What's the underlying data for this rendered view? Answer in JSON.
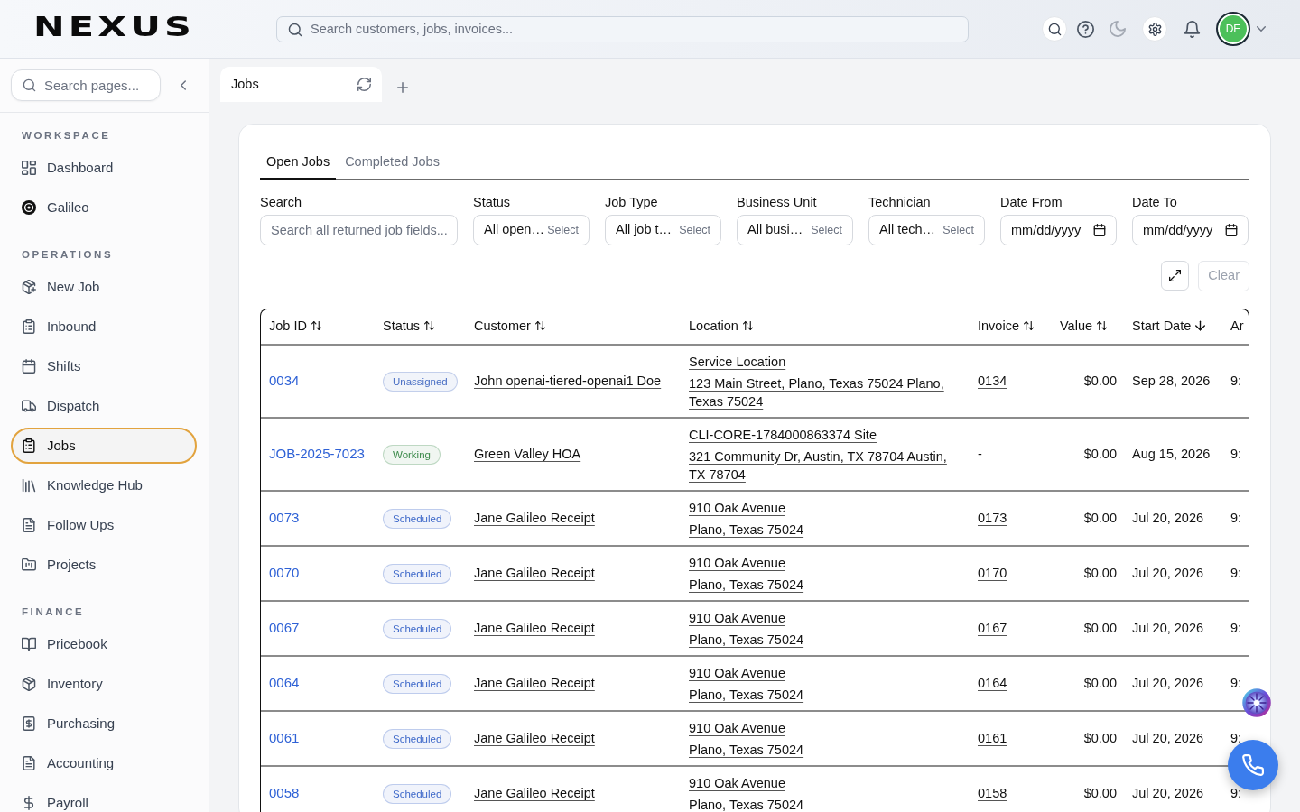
{
  "header": {
    "logo": "NEXUS",
    "search": {
      "placeholder": "Search customers, jobs, invoices..."
    },
    "avatar": {
      "initials": "DE"
    }
  },
  "sidebar": {
    "search": {
      "placeholder": "Search pages..."
    },
    "sections": [
      {
        "title": "WORKSPACE",
        "items": [
          {
            "label": "Dashboard",
            "selected": false
          },
          {
            "label": "Galileo",
            "selected": false
          }
        ]
      },
      {
        "title": "OPERATIONS",
        "items": [
          {
            "label": "New Job",
            "selected": false
          },
          {
            "label": "Inbound",
            "selected": false
          },
          {
            "label": "Shifts",
            "selected": false
          },
          {
            "label": "Dispatch",
            "selected": false
          },
          {
            "label": "Jobs",
            "selected": true
          },
          {
            "label": "Knowledge Hub",
            "selected": false
          },
          {
            "label": "Follow Ups",
            "selected": false
          },
          {
            "label": "Projects",
            "selected": false
          }
        ]
      },
      {
        "title": "FINANCE",
        "items": [
          {
            "label": "Pricebook",
            "selected": false
          },
          {
            "label": "Inventory",
            "selected": false
          },
          {
            "label": "Purchasing",
            "selected": false
          },
          {
            "label": "Accounting",
            "selected": false
          },
          {
            "label": "Payroll",
            "selected": false
          }
        ]
      }
    ]
  },
  "page_tabs": [
    {
      "label": "Jobs",
      "selected": true
    }
  ],
  "jobs_panel": {
    "tabs": [
      {
        "label": "Open Jobs",
        "selected": true
      },
      {
        "label": "Completed Jobs",
        "selected": false
      }
    ],
    "filters": [
      {
        "kind": "text",
        "label": "Search",
        "placeholder": "Search all returned job fields..."
      },
      {
        "kind": "select",
        "label": "Status",
        "value": "All open…",
        "hint": "Select"
      },
      {
        "kind": "select",
        "label": "Job Type",
        "value": "All job t…",
        "hint": "Select"
      },
      {
        "kind": "select",
        "label": "Business Unit",
        "value": "All busi…",
        "hint": "Select"
      },
      {
        "kind": "select",
        "label": "Technician",
        "value": "All tech…",
        "hint": "Select"
      },
      {
        "kind": "date",
        "label": "Date From",
        "placeholder": "mm/dd/yyyy"
      },
      {
        "kind": "date",
        "label": "Date To",
        "placeholder": "mm/dd/yyyy"
      }
    ],
    "clear_button": {
      "label": "Clear",
      "disabled": true
    },
    "table": {
      "columns": [
        {
          "label": "Job ID",
          "sorted": false
        },
        {
          "label": "Status",
          "sorted": false
        },
        {
          "label": "Customer",
          "sorted": false
        },
        {
          "label": "Location",
          "sorted": false
        },
        {
          "label": "Invoice",
          "sorted": false
        },
        {
          "label": "Value",
          "sorted": false
        },
        {
          "label": "Start Date",
          "sorted": true
        },
        {
          "label": "Ar"
        }
      ],
      "rows": [
        {
          "job_id": "0034",
          "status": {
            "label": "Unassigned",
            "color": "#4a6fc4"
          },
          "customer": "John openai-tiered-openai1 Doe",
          "location": [
            "Service Location",
            "123 Main Street, Plano, Texas 75024 Plano, Texas 75024"
          ],
          "invoice": {
            "text": "0134",
            "link": true
          },
          "value": "$0.00",
          "start_date": "Sep 28, 2026",
          "column_8": "9:"
        },
        {
          "job_id": "JOB-2025-7023",
          "status": {
            "label": "Working",
            "color": "#3d8b4c"
          },
          "customer": "Green Valley HOA",
          "location": [
            "CLI-CORE-1784000863374 Site",
            "321 Community Dr, Austin, TX 78704 Austin, TX 78704"
          ],
          "invoice": {
            "text": "-",
            "link": false
          },
          "value": "$0.00",
          "start_date": "Aug 15, 2026",
          "column_8": "9:"
        },
        {
          "job_id": "0073",
          "status": {
            "label": "Scheduled",
            "color": "#3d68c9"
          },
          "customer": "Jane Galileo Receipt",
          "location": [
            "910 Oak Avenue",
            "Plano, Texas 75024"
          ],
          "invoice": {
            "text": "0173",
            "link": true
          },
          "value": "$0.00",
          "start_date": "Jul 20, 2026",
          "column_8": "9:"
        },
        {
          "job_id": "0070",
          "status": {
            "label": "Scheduled",
            "color": "#3d68c9"
          },
          "customer": "Jane Galileo Receipt",
          "location": [
            "910 Oak Avenue",
            "Plano, Texas 75024"
          ],
          "invoice": {
            "text": "0170",
            "link": true
          },
          "value": "$0.00",
          "start_date": "Jul 20, 2026",
          "column_8": "9:"
        },
        {
          "job_id": "0067",
          "status": {
            "label": "Scheduled",
            "color": "#3d68c9"
          },
          "customer": "Jane Galileo Receipt",
          "location": [
            "910 Oak Avenue",
            "Plano, Texas 75024"
          ],
          "invoice": {
            "text": "0167",
            "link": true
          },
          "value": "$0.00",
          "start_date": "Jul 20, 2026",
          "column_8": "9:"
        },
        {
          "job_id": "0064",
          "status": {
            "label": "Scheduled",
            "color": "#3d68c9"
          },
          "customer": "Jane Galileo Receipt",
          "location": [
            "910 Oak Avenue",
            "Plano, Texas 75024"
          ],
          "invoice": {
            "text": "0164",
            "link": true
          },
          "value": "$0.00",
          "start_date": "Jul 20, 2026",
          "column_8": "9:"
        },
        {
          "job_id": "0061",
          "status": {
            "label": "Scheduled",
            "color": "#3d68c9"
          },
          "customer": "Jane Galileo Receipt",
          "location": [
            "910 Oak Avenue",
            "Plano, Texas 75024"
          ],
          "invoice": {
            "text": "0161",
            "link": true
          },
          "value": "$0.00",
          "start_date": "Jul 20, 2026",
          "column_8": "9:"
        },
        {
          "job_id": "0058",
          "status": {
            "label": "Scheduled",
            "color": "#3d68c9"
          },
          "customer": "Jane Galileo Receipt",
          "location": [
            "910 Oak Avenue",
            "Plano, Texas 75024"
          ],
          "invoice": {
            "text": "0158",
            "link": true
          },
          "value": "$0.00",
          "start_date": "Jul 20, 2026",
          "column_8": "9:"
        }
      ]
    }
  }
}
